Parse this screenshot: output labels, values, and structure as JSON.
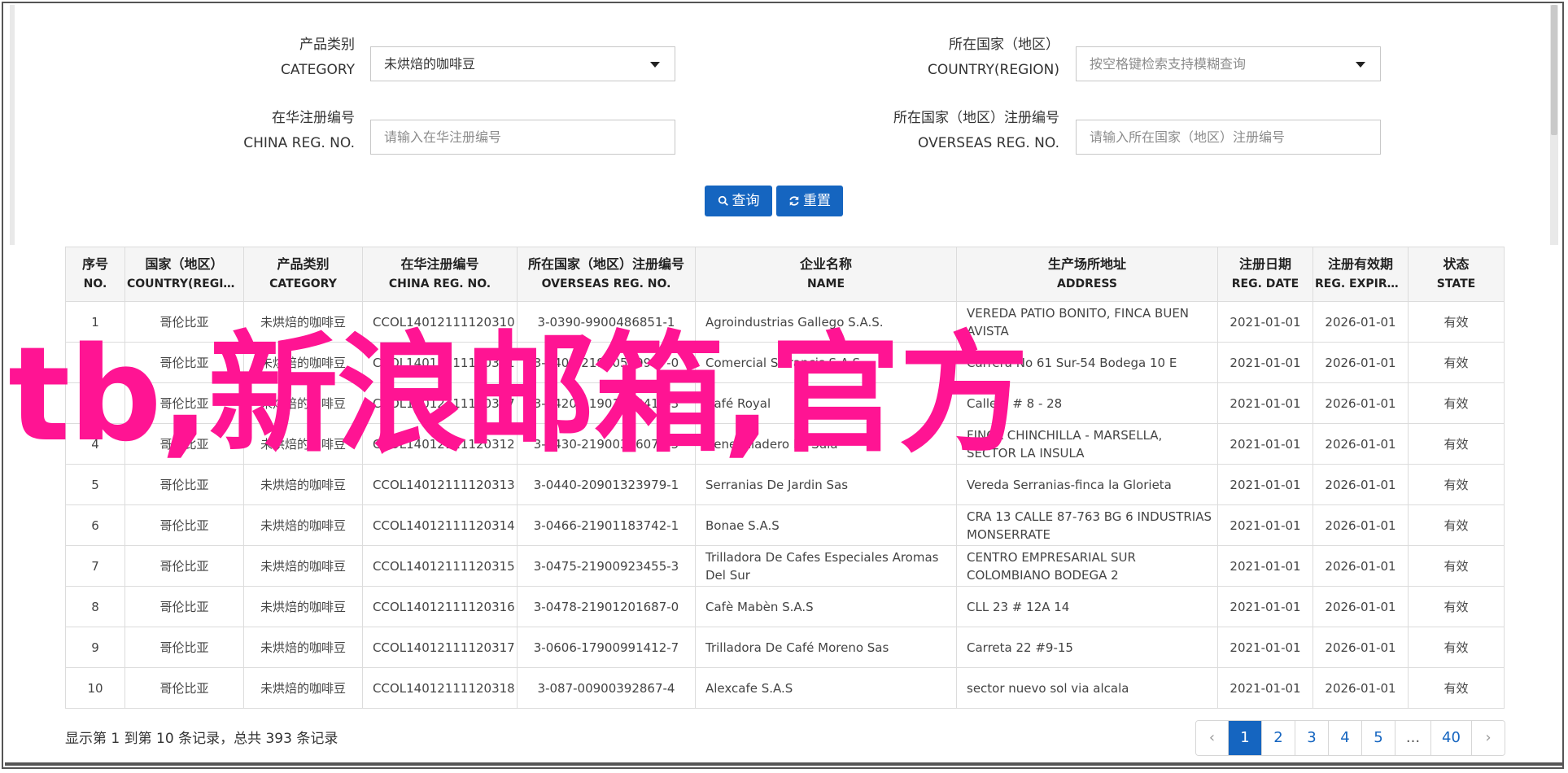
{
  "filters": {
    "category": {
      "label_cn": "产品类别",
      "label_en": "CATEGORY",
      "value": "未烘焙的咖啡豆"
    },
    "country": {
      "label_cn": "所在国家（地区）",
      "label_en": "COUNTRY(REGION)",
      "placeholder": "按空格键检索支持模糊查询"
    },
    "china_reg": {
      "label_cn": "在华注册编号",
      "label_en": "CHINA REG. NO.",
      "placeholder": "请输入在华注册编号"
    },
    "overseas_reg": {
      "label_cn": "所在国家（地区）注册编号",
      "label_en": "OVERSEAS REG. NO.",
      "placeholder": "请输入所在国家（地区）注册编号"
    }
  },
  "buttons": {
    "search": "查询",
    "reset": "重置"
  },
  "table": {
    "headers": [
      {
        "cn": "序号",
        "en": "NO."
      },
      {
        "cn": "国家（地区）",
        "en": "COUNTRY(REGIO..."
      },
      {
        "cn": "产品类别",
        "en": "CATEGORY"
      },
      {
        "cn": "在华注册编号",
        "en": "CHINA REG. NO."
      },
      {
        "cn": "所在国家（地区）注册编号",
        "en": "OVERSEAS REG. NO."
      },
      {
        "cn": "企业名称",
        "en": "NAME"
      },
      {
        "cn": "生产场所地址",
        "en": "ADDRESS"
      },
      {
        "cn": "注册日期",
        "en": "REG. DATE"
      },
      {
        "cn": "注册有效期",
        "en": "REG. EXPIRE ..."
      },
      {
        "cn": "状态",
        "en": "STATE"
      }
    ],
    "rows": [
      [
        "1",
        "哥伦比亚",
        "未烘焙的咖啡豆",
        "CCOL14012111120310",
        "3-0390-9900486851-1",
        "Agroindustrias Gallego S.A.S.",
        "VEREDA PATIO BONITO, FINCA BUEN AVISTA",
        "2021-01-01",
        "2026-01-01",
        "有效"
      ],
      [
        "2",
        "哥伦比亚",
        "未烘焙的咖啡豆",
        "CCOL14012111120311",
        "3-0400-21900509977-0",
        "Comercial S Francis S.A.S.",
        "Carrera No 61 Sur-54 Bodega 10 E",
        "2021-01-01",
        "2026-01-01",
        "有效"
      ],
      [
        "3",
        "哥伦比亚",
        "未烘焙的咖啡豆",
        "CCOL14012111120347",
        "3-0420-21901453417-3",
        "Café Royal",
        "Calle 2 # 8 - 28",
        "2021-01-01",
        "2026-01-01",
        "有效"
      ],
      [
        "4",
        "哥伦比亚",
        "未烘焙的咖啡豆",
        "CCOL14012111120312",
        "3-0430-21900366073-5",
        "Beneficiadero La Sula",
        "FINCA CHINCHILLA - MARSELLA, SECTOR LA INSULA",
        "2021-01-01",
        "2026-01-01",
        "有效"
      ],
      [
        "5",
        "哥伦比亚",
        "未烘焙的咖啡豆",
        "CCOL14012111120313",
        "3-0440-20901323979-1",
        "Serranias De Jardin Sas",
        "Vereda Serranias-finca la Glorieta",
        "2021-01-01",
        "2026-01-01",
        "有效"
      ],
      [
        "6",
        "哥伦比亚",
        "未烘焙的咖啡豆",
        "CCOL14012111120314",
        "3-0466-21901183742-1",
        "Bonae S.A.S",
        "CRA 13 CALLE 87-763 BG 6 INDUSTRIAS MONSERRATE",
        "2021-01-01",
        "2026-01-01",
        "有效"
      ],
      [
        "7",
        "哥伦比亚",
        "未烘焙的咖啡豆",
        "CCOL14012111120315",
        "3-0475-21900923455-3",
        "Trilladora De Cafes Especiales Aromas Del Sur",
        "CENTRO EMPRESARIAL SUR COLOMBIANO BODEGA 2",
        "2021-01-01",
        "2026-01-01",
        "有效"
      ],
      [
        "8",
        "哥伦比亚",
        "未烘焙的咖啡豆",
        "CCOL14012111120316",
        "3-0478-21901201687-0",
        "Cafè Mabèn S.A.S",
        "CLL 23 # 12A 14",
        "2021-01-01",
        "2026-01-01",
        "有效"
      ],
      [
        "9",
        "哥伦比亚",
        "未烘焙的咖啡豆",
        "CCOL14012111120317",
        "3-0606-17900991412-7",
        "Trilladora De Café Moreno Sas",
        "Carreta 22 #9-15",
        "2021-01-01",
        "2026-01-01",
        "有效"
      ],
      [
        "10",
        "哥伦比亚",
        "未烘焙的咖啡豆",
        "CCOL14012111120318",
        "3-087-00900392867-4",
        "Alexcafe S.A.S",
        "sector nuevo sol via alcala",
        "2021-01-01",
        "2026-01-01",
        "有效"
      ]
    ]
  },
  "footer": {
    "summary": "显示第 1 到第 10 条记录，总共 393 条记录"
  },
  "pagination": {
    "prev": "‹",
    "pages": [
      "1",
      "2",
      "3",
      "4",
      "5",
      "...",
      "40"
    ],
    "next": "›",
    "active": "1"
  },
  "overlay_text": "tb,新浪邮箱,官方",
  "colors": {
    "accent": "#1565c0",
    "overlay": "#ff1493"
  }
}
